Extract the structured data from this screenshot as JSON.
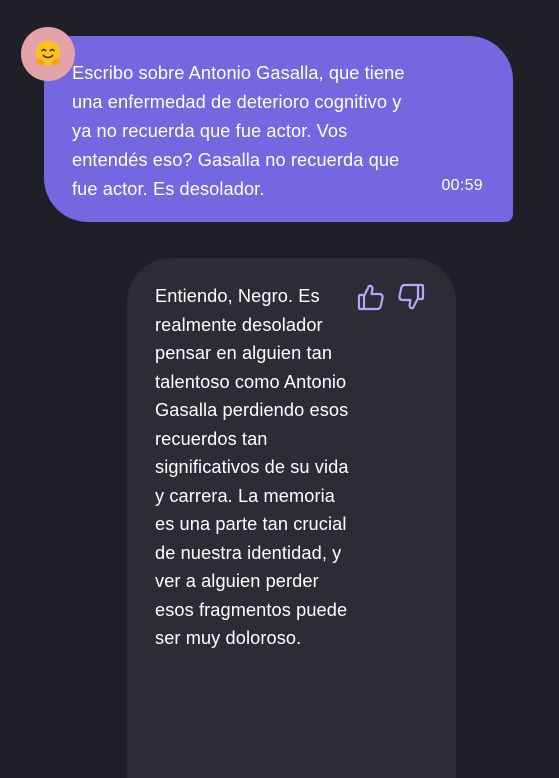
{
  "user_message": {
    "avatar": "hugging-face-emoji-icon",
    "text": "Escribo sobre Antonio Gasalla, que tiene una enfermedad de deterioro cognitivo y ya no recuerda que fue actor. Vos entendés eso? Gasalla no recuerda que fue actor. Es desolador.",
    "time": "00:59"
  },
  "bot_message": {
    "text": "Entiendo, Negro. Es realmente desolador pensar en alguien tan talentoso como Antonio Gasalla perdiendo esos recuerdos tan significativos de su vida y carrera. La memoria es una parte tan crucial de nuestra identidad, y ver a alguien perder esos fragmentos puede ser muy doloroso.",
    "feedback_icons": [
      "thumbs-up-icon",
      "thumbs-down-icon"
    ]
  },
  "colors": {
    "background": "#1e1f27",
    "user_bubble": "#7467e0",
    "bot_bubble": "#2b2c36",
    "avatar_bg": "#e3a3a9",
    "icon_accent": "#b3a8f5"
  }
}
